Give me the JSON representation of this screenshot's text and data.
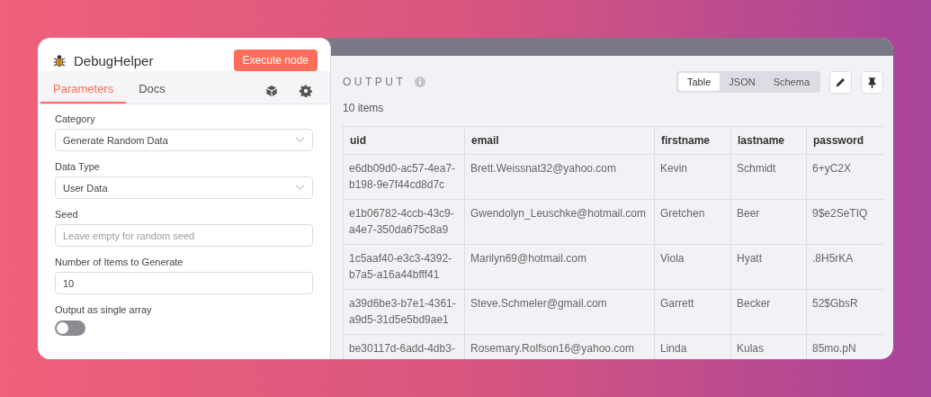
{
  "node": {
    "title": "DebugHelper",
    "execute_button": "Execute node"
  },
  "tabs": [
    {
      "label": "Parameters",
      "selected": true
    },
    {
      "label": "Docs",
      "selected": false
    }
  ],
  "fields": [
    {
      "kind": "select",
      "label": "Category",
      "value": "Generate Random Data"
    },
    {
      "kind": "select",
      "label": "Data Type",
      "value": "User Data"
    },
    {
      "kind": "text",
      "label": "Seed",
      "placeholder": "Leave empty for random seed"
    },
    {
      "kind": "text",
      "label": "Number of Items to Generate",
      "value": "10"
    },
    {
      "kind": "toggle",
      "label": "Output as single array",
      "on": false
    }
  ],
  "output": {
    "title": "OUTPUT",
    "count": "10 items",
    "views": [
      {
        "label": "Table",
        "selected": true
      },
      {
        "label": "JSON",
        "selected": false
      },
      {
        "label": "Schema",
        "selected": false
      }
    ],
    "table": {
      "columns": [
        "uid",
        "email",
        "firstname",
        "lastname",
        "password"
      ],
      "rows": [
        [
          "e6db09d0-ac57-4ea7-b198-9e7f44cd8d7c",
          "Brett.Weissnat32@yahoo.com",
          "Kevin",
          "Schmidt",
          "6+yC2X"
        ],
        [
          "e1b06782-4ccb-43c9-a4e7-350da675c8a9",
          "Gwendolyn_Leuschke@hotmail.com",
          "Gretchen",
          "Beer",
          "9$e2SeTIQ"
        ],
        [
          "1c5aaf40-e3c3-4392-b7a5-a16a44bfff41",
          "Marilyn69@hotmail.com",
          "Viola",
          "Hyatt",
          ".8H5rKA"
        ],
        [
          "a39d6be3-b7e1-4361-a9d5-31d5e5bd9ae1",
          "Steve.Schmeler@gmail.com",
          "Garrett",
          "Becker",
          "52$GbsR"
        ],
        [
          "be30117d-6add-4db3-",
          "Rosemary.Rolfson16@yahoo.com",
          "Linda",
          "Kulas",
          "85mo.pN"
        ]
      ]
    }
  }
}
